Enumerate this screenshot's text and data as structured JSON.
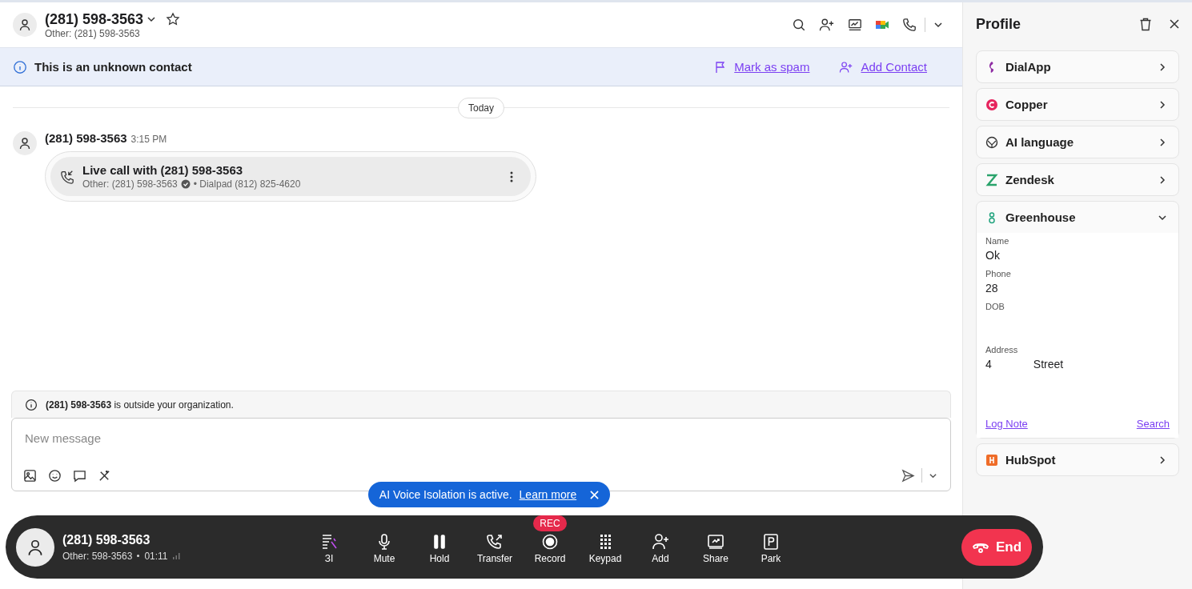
{
  "header": {
    "title": "(281) 598-3563",
    "subtitle": "Other: (281) 598-3563",
    "starred": false
  },
  "banner": {
    "text": "This is an unknown contact",
    "actions": [
      "Mark as spam",
      "Add Contact"
    ]
  },
  "conversation": {
    "date": "Today",
    "sender": "(281) 598-3563",
    "time": "3:15 PM",
    "call_title": "Live call with (281) 598-3563",
    "call_other": "Other: (281) 598-3563",
    "call_line": "• Dialpad (812) 825-4620"
  },
  "notice": {
    "text": "**(281) 598-3563** is outside your organization."
  },
  "composer": {
    "placeholder": "New message"
  },
  "toast": {
    "text": "AI Voice Isolation is active.",
    "link": "Learn more"
  },
  "call_bar": {
    "name": "(281) 598-3563",
    "other": "Other: 598-3563",
    "duration": "01:11",
    "end": "End",
    "actions": [
      {
        "kind": "ai",
        "label": "ЗI"
      },
      {
        "kind": "mute",
        "label": "Mute"
      },
      {
        "kind": "hold",
        "label": "Hold"
      },
      {
        "kind": "transfer",
        "label": "Transfer"
      },
      {
        "kind": "record",
        "label": "Record",
        "badge": "REC"
      },
      {
        "kind": "keypad",
        "label": "Keypad"
      },
      {
        "kind": "add",
        "label": "Add"
      },
      {
        "kind": "share",
        "label": "Share"
      },
      {
        "kind": "park",
        "label": "Park"
      }
    ]
  },
  "profile": {
    "title": "Profile",
    "integrations": [
      {
        "name": "DialApp",
        "expanded": false
      },
      {
        "name": "Copper",
        "expanded": false
      },
      {
        "name": "AI language",
        "expanded": false
      },
      {
        "name": "Zendesk",
        "expanded": false
      },
      {
        "name": "Greenhouse",
        "expanded": true,
        "fields": [
          {
            "label": "Name",
            "parts": [
              "Ok"
            ]
          },
          {
            "label": "Phone",
            "parts": [
              "28"
            ]
          },
          {
            "label": "DOB"
          },
          {
            "label": "Address",
            "parts": [
              "4",
              "Street"
            ]
          }
        ],
        "links": [
          "Log Note",
          "Search"
        ]
      },
      {
        "name": "HubSpot",
        "expanded": false
      }
    ]
  }
}
